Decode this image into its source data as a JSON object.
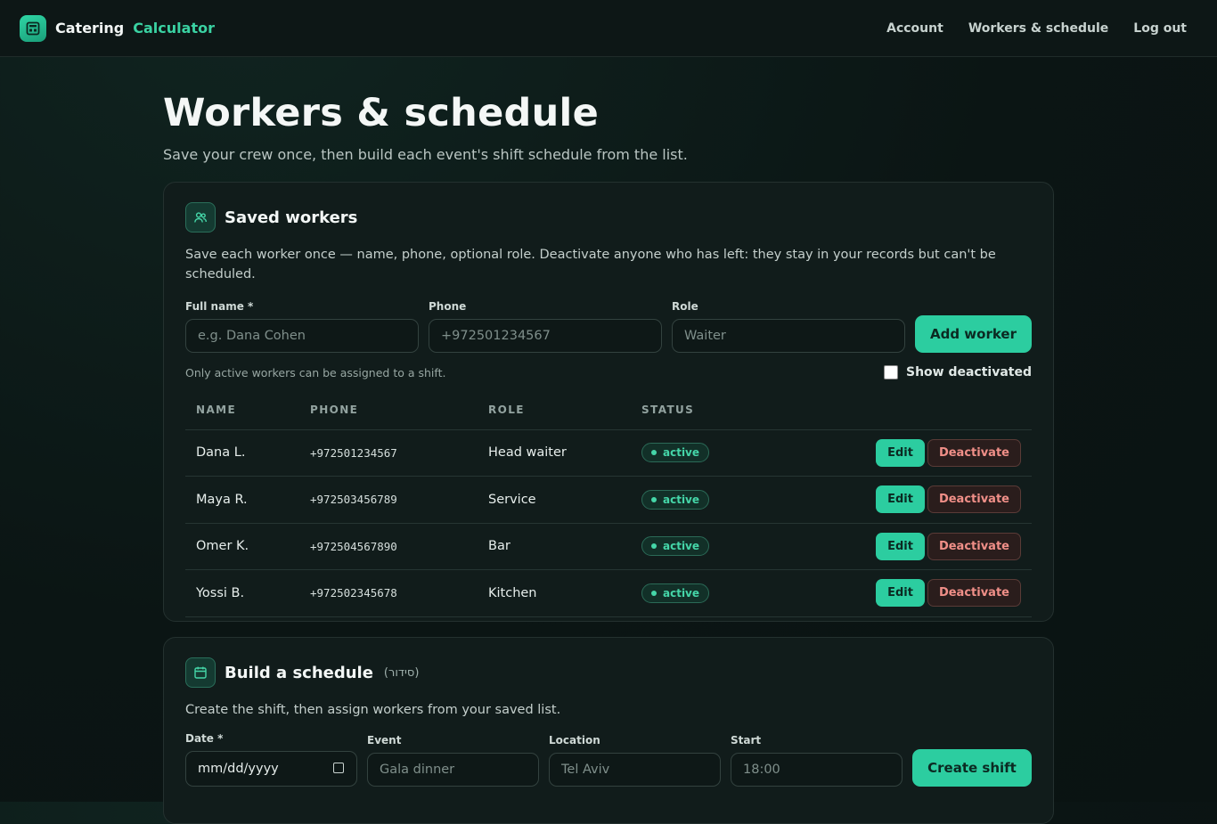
{
  "brand": {
    "name_a": "Catering",
    "name_b": "Calculator"
  },
  "nav": {
    "items": [
      "Account",
      "Workers & schedule",
      "Log out"
    ]
  },
  "page": {
    "title": "Workers & schedule",
    "subtitle": "Save your crew once, then build each event's shift schedule from the list."
  },
  "workers_card": {
    "title": "Saved workers",
    "description": "Save each worker once — name, phone, optional role. Deactivate anyone who has left: they stay in your records but can't be scheduled.",
    "fields": {
      "name_label": "Full name *",
      "name_placeholder": "e.g. Dana Cohen",
      "phone_label": "Phone",
      "phone_placeholder": "+972501234567",
      "role_label": "Role",
      "role_placeholder": "Waiter"
    },
    "add_button": "Add worker",
    "helper": "Only active workers can be assigned to a shift.",
    "show_deactivated_label": "Show deactivated",
    "show_deactivated_checked": false,
    "columns": [
      "NAME",
      "PHONE",
      "ROLE",
      "STATUS"
    ],
    "edit_label": "Edit",
    "deactivate_label": "Deactivate",
    "rows": [
      {
        "name": "Dana L.",
        "phone": "+972501234567",
        "role": "Head waiter",
        "status": "active"
      },
      {
        "name": "Maya R.",
        "phone": "+972503456789",
        "role": "Service",
        "status": "active"
      },
      {
        "name": "Omer K.",
        "phone": "+972504567890",
        "role": "Bar",
        "status": "active"
      },
      {
        "name": "Yossi B.",
        "phone": "+972502345678",
        "role": "Kitchen",
        "status": "active"
      }
    ]
  },
  "schedule_card": {
    "title": "Build a schedule",
    "hint": "(סידור)",
    "description": "Create the shift, then assign workers from your saved list.",
    "fields": {
      "date_label": "Date *",
      "date_value": "mm/dd/yyyy",
      "event_label": "Event",
      "event_placeholder": "Gala dinner",
      "location_label": "Location",
      "location_placeholder": "Tel Aviv",
      "start_label": "Start",
      "start_placeholder": "18:00"
    },
    "create_button": "Create shift"
  },
  "colors": {
    "accent": "#2ccda0",
    "background": "#0b1514",
    "danger": "#f08f88"
  }
}
